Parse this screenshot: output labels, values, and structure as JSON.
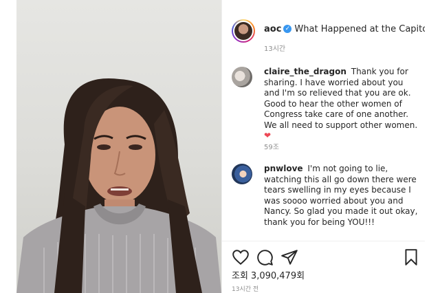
{
  "post": {
    "username": "aoc",
    "caption": "What Happened at the Capitol.",
    "caption_time": "13시간"
  },
  "comments": [
    {
      "username": "claire_the_dragon",
      "text": "Thank you for sharing. I have worried about you and I'm so relieved that you are ok. Good to hear the other women of Congress take care of one another. We all need to support other women.",
      "emoji": "❤",
      "likes": "59조"
    },
    {
      "username": "pnwlove",
      "text": "I'm not going to lie, watching this all go down there were tears swelling in my eyes because I was soooo worried about you and Nancy. So glad you made it out okay, thank you for being YOU!!!"
    }
  ],
  "stats": {
    "views_label": "조회",
    "views_count": "3,090,479회",
    "post_time": "13시간 전"
  },
  "icons": [
    "heart-icon",
    "comment-icon",
    "share-icon",
    "bookmark-icon",
    "verified-icon"
  ],
  "colors": {
    "verified": "#3897f0",
    "heart_emoji": "#ed4956",
    "text": "#262626",
    "muted": "#8e8e8e"
  }
}
